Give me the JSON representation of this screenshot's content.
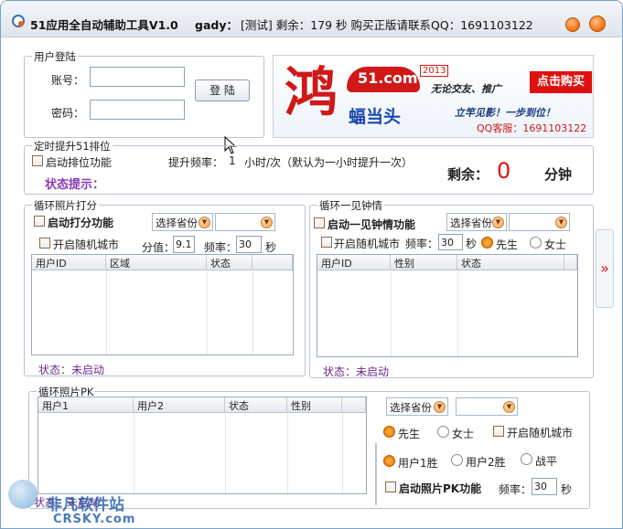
{
  "title": {
    "app": "51应用全自动辅助工具V1.0",
    "user": "gady：",
    "trial": "[测试] 剩余：179 秒 购买正版请联系QQ：1691103122"
  },
  "login": {
    "group": "用户登陆",
    "account_label": "账号：",
    "password_label": "密码：",
    "account_value": "",
    "password_value": "",
    "login_button": "登 陆"
  },
  "banner": {
    "big_char": "鸿",
    "site": "51.com",
    "year": "2013",
    "slogan1": "无论交友、推广",
    "bat_text": "蝠当头",
    "slogan2": "立竿见影！一步到位！",
    "qq": "QQ客服：1691103122",
    "buy": "点击购买"
  },
  "ranking": {
    "group": "定时提升51排位",
    "enable": "启动排位功能",
    "freq_label": "提升频率：",
    "freq_value": "1",
    "freq_unit": "小时/次（默认为一小时提升一次）",
    "status_hint": "状态提示：",
    "remain_label": "剩余：",
    "remain_value": "0",
    "remain_unit": "分钟"
  },
  "scoring": {
    "group": "循环照片打分",
    "enable": "启动打分功能",
    "province": "选择省份",
    "random_city": "开启随机城市",
    "score_label": "分值：",
    "score_value": "9.1",
    "rate_label": "频率：",
    "rate_value": "30",
    "sec": "秒",
    "columns": [
      "用户ID",
      "区域",
      "状态",
      ""
    ],
    "status": "状态：未启动"
  },
  "love": {
    "group": "循环一见钟情",
    "enable": "启动一见钟情功能",
    "province": "选择省份",
    "random_city": "开启随机城市",
    "rate_label": "频率：",
    "rate_value": "30",
    "sec": "秒",
    "male": "先生",
    "female": "女士",
    "columns": [
      "用户ID",
      "性别",
      "状态",
      ""
    ],
    "status": "状态：未启动"
  },
  "side_arrow": "»",
  "pk": {
    "group": "循环照片PK",
    "columns": [
      "用户1",
      "用户2",
      "状态",
      "性别",
      ""
    ],
    "province": "选择省份",
    "male": "先生",
    "female": "女士",
    "random_city": "开启随机城市",
    "user1_win": "用户1胜",
    "user2_win": "用户2胜",
    "draw": "战平",
    "enable": "启动照片PK功能",
    "rate_label": "频率：",
    "rate_value": "30",
    "sec": "秒",
    "status": "状态：未启动"
  },
  "watermark": {
    "cn": "非凡软件站",
    "en": "CRSKY.com"
  },
  "colors": {
    "accent": "#f07010",
    "purple": "#6a2a8a",
    "red": "#e01010"
  }
}
